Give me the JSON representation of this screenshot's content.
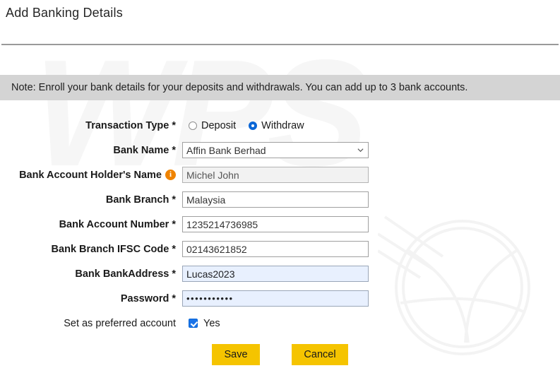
{
  "page": {
    "title": "Add Banking Details"
  },
  "note": {
    "text": "Note: Enroll your bank details for your deposits and withdrawals. You can add up to 3 bank accounts."
  },
  "form": {
    "transaction_type": {
      "label": "Transaction Type *",
      "options": [
        {
          "label": "Deposit",
          "selected": false
        },
        {
          "label": "Withdraw",
          "selected": true
        }
      ]
    },
    "bank_name": {
      "label": "Bank Name *",
      "value": "Affin Bank Berhad",
      "icon": "chevron-down-icon"
    },
    "account_holder_name": {
      "label": "Bank Account Holder's Name",
      "icon": "info-icon",
      "value": "Michel John",
      "state": "readonly"
    },
    "bank_branch": {
      "label": "Bank Branch *",
      "value": "Malaysia"
    },
    "bank_account_number": {
      "label": "Bank Account Number *",
      "value": "1235214736985"
    },
    "bank_branch_ifsc_code": {
      "label": "Bank Branch IFSC Code *",
      "value": "02143621852"
    },
    "bank_bankaddress": {
      "label": "Bank BankAddress *",
      "value": "Lucas2023",
      "state": "autofilled"
    },
    "password": {
      "label": "Password *",
      "value": "•••••••••••",
      "state": "autofilled"
    },
    "preferred_account": {
      "label": "Set as preferred account",
      "checkbox_label": "Yes",
      "checked": true
    }
  },
  "actions": {
    "save_label": "Save",
    "cancel_label": "Cancel"
  },
  "colors": {
    "button_background": "#f5c400",
    "note_background": "#d4d4d4",
    "info_icon": "#ef8300",
    "radio_selected": "#0a66d6",
    "checkbox_checked": "#1a73e8",
    "autofill_background": "#e8f0fe"
  },
  "watermark": {
    "text": "WPS"
  }
}
